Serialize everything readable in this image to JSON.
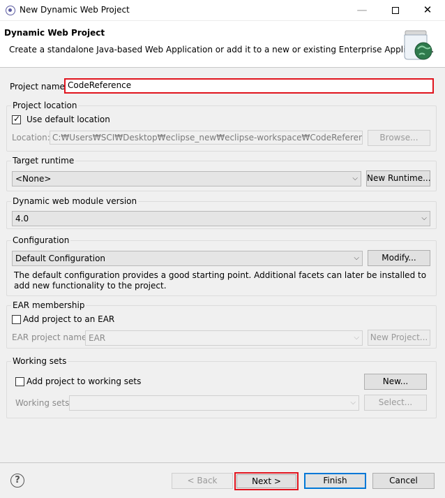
{
  "window": {
    "title": "New Dynamic Web Project",
    "minimize": "—",
    "close": "✕"
  },
  "header": {
    "title": "Dynamic Web Project",
    "description": "Create a standalone Java-based Web Application or add it to a new or existing Enterprise Application."
  },
  "project_name": {
    "label": "Project name:",
    "value": "CodeReference"
  },
  "project_location": {
    "group_label": "Project location",
    "use_default_label": "Use default location",
    "use_default_checked": true,
    "location_label": "Location:",
    "location_value": "C:₩Users₩SCI₩Desktop₩eclipse_new₩eclipse-workspace₩CodeReference",
    "browse_label": "Browse..."
  },
  "target_runtime": {
    "group_label": "Target runtime",
    "selected": "<None>",
    "new_runtime_label": "New Runtime..."
  },
  "web_module": {
    "group_label": "Dynamic web module version",
    "selected": "4.0"
  },
  "configuration": {
    "group_label": "Configuration",
    "selected": "Default Configuration",
    "modify_label": "Modify...",
    "description": "The default configuration provides a good starting point. Additional facets can later be installed to add new functionality to the project."
  },
  "ear": {
    "group_label": "EAR membership",
    "add_label": "Add project to an EAR",
    "add_checked": false,
    "project_name_label": "EAR project name:",
    "project_name_value": "EAR",
    "new_project_label": "New Project..."
  },
  "working_sets": {
    "group_label": "Working sets",
    "add_label": "Add project to working sets",
    "add_checked": false,
    "new_label": "New...",
    "sets_label": "Working sets:",
    "select_label": "Select..."
  },
  "footer": {
    "help_glyph": "?",
    "back_label": "< Back",
    "next_label": "Next >",
    "finish_label": "Finish",
    "cancel_label": "Cancel"
  }
}
